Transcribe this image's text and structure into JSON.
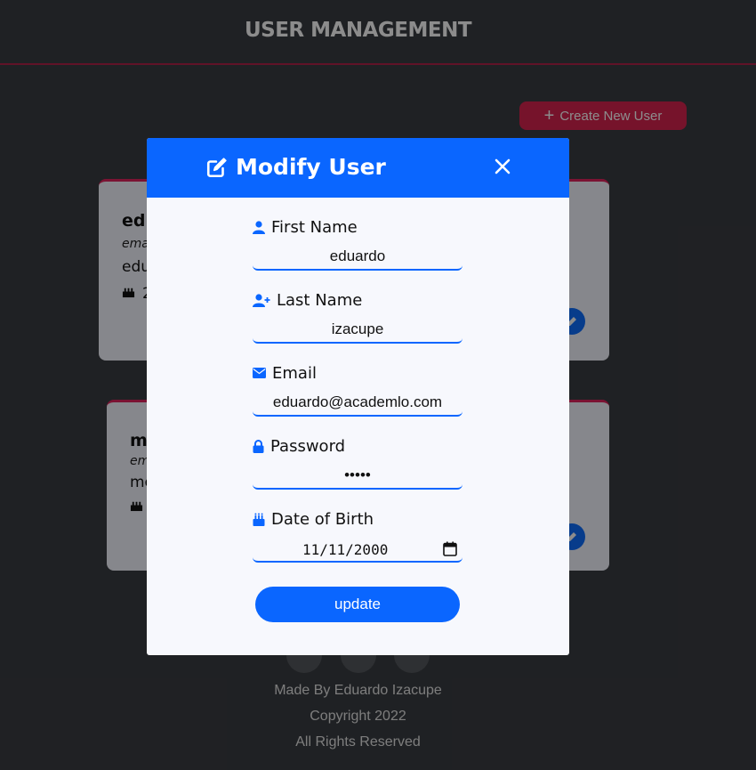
{
  "header": {
    "title": "USER MANAGEMENT"
  },
  "toolbar": {
    "create_label": "Create New User"
  },
  "cards": [
    {
      "name": "edu",
      "email": "ema",
      "line": "edu",
      "birthday": "2"
    },
    {
      "name": "m",
      "email": "em",
      "line": "me",
      "birthday": ""
    }
  ],
  "footer": {
    "made_by": "Made By Eduardo Izacupe",
    "copyright": "Copyright 2022",
    "rights": "All Rights Reserved"
  },
  "modal": {
    "title": "Modify User",
    "fields": {
      "first_name": {
        "label": "First Name",
        "value": "eduardo"
      },
      "last_name": {
        "label": "Last Name",
        "value": "izacupe"
      },
      "email": {
        "label": "Email",
        "value": "eduardo@academlo.com"
      },
      "password": {
        "label": "Password",
        "value": "•••••"
      },
      "birth": {
        "label": "Date of Birth",
        "value": "11/11/2000"
      }
    },
    "submit_label": "update"
  },
  "colors": {
    "primary": "#0a66ff",
    "accent": "#d8234f",
    "overlay": "rgba(0,0,0,0.45)"
  },
  "icons": [
    "edit-icon",
    "close-icon",
    "user-icon",
    "user-plus-icon",
    "envelope-icon",
    "lock-icon",
    "birthday-cake-icon",
    "calendar-icon",
    "plus-icon",
    "instagram-icon",
    "github-icon",
    "linkedin-icon"
  ]
}
